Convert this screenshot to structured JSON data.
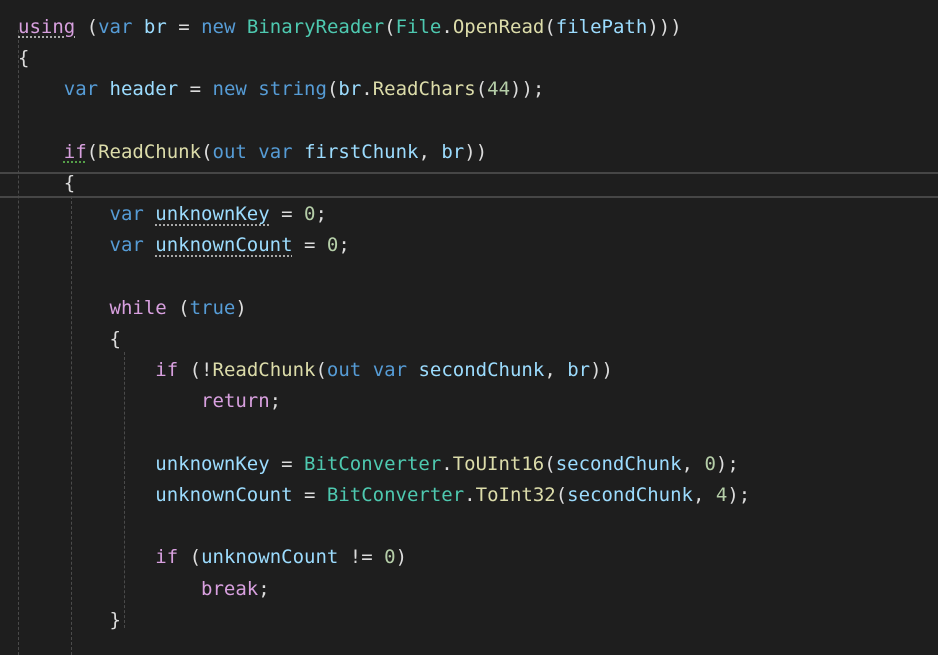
{
  "lines": [
    {
      "tokens": [
        {
          "t": "using",
          "c": "ctl",
          "sq": "plain"
        },
        {
          "t": " (",
          "c": "pun"
        },
        {
          "t": "var",
          "c": "kw"
        },
        {
          "t": " ",
          "c": "pun"
        },
        {
          "t": "br",
          "c": "var"
        },
        {
          "t": " = ",
          "c": "pun"
        },
        {
          "t": "new",
          "c": "kw"
        },
        {
          "t": " ",
          "c": "pun"
        },
        {
          "t": "BinaryReader",
          "c": "type"
        },
        {
          "t": "(",
          "c": "pun"
        },
        {
          "t": "File",
          "c": "type"
        },
        {
          "t": ".",
          "c": "pun"
        },
        {
          "t": "OpenRead",
          "c": "mth"
        },
        {
          "t": "(",
          "c": "pun"
        },
        {
          "t": "filePath",
          "c": "var"
        },
        {
          "t": ")))",
          "c": "pun"
        }
      ]
    },
    {
      "tokens": [
        {
          "t": "{",
          "c": "pun"
        }
      ]
    },
    {
      "tokens": [
        {
          "t": "    ",
          "c": "pun"
        },
        {
          "t": "var",
          "c": "kw"
        },
        {
          "t": " ",
          "c": "pun"
        },
        {
          "t": "header",
          "c": "var"
        },
        {
          "t": " = ",
          "c": "pun"
        },
        {
          "t": "new",
          "c": "kw"
        },
        {
          "t": " ",
          "c": "pun"
        },
        {
          "t": "string",
          "c": "kw"
        },
        {
          "t": "(",
          "c": "pun"
        },
        {
          "t": "br",
          "c": "var"
        },
        {
          "t": ".",
          "c": "pun"
        },
        {
          "t": "ReadChars",
          "c": "mth"
        },
        {
          "t": "(",
          "c": "pun"
        },
        {
          "t": "44",
          "c": "num"
        },
        {
          "t": "));",
          "c": "pun"
        }
      ]
    },
    {
      "tokens": []
    },
    {
      "tokens": [
        {
          "t": "    ",
          "c": "pun"
        },
        {
          "t": "if",
          "c": "ctl",
          "sq": "green"
        },
        {
          "t": "(",
          "c": "pun"
        },
        {
          "t": "ReadChunk",
          "c": "mth"
        },
        {
          "t": "(",
          "c": "pun"
        },
        {
          "t": "out",
          "c": "kw"
        },
        {
          "t": " ",
          "c": "pun"
        },
        {
          "t": "var",
          "c": "kw"
        },
        {
          "t": " ",
          "c": "pun"
        },
        {
          "t": "firstChunk",
          "c": "var"
        },
        {
          "t": ", ",
          "c": "pun"
        },
        {
          "t": "br",
          "c": "var"
        },
        {
          "t": "))",
          "c": "pun"
        }
      ]
    },
    {
      "tokens": [
        {
          "t": "    ",
          "c": "pun"
        },
        {
          "t": "{",
          "c": "pun"
        }
      ]
    },
    {
      "tokens": [
        {
          "t": "        ",
          "c": "pun"
        },
        {
          "t": "var",
          "c": "kw"
        },
        {
          "t": " ",
          "c": "pun"
        },
        {
          "t": "unknownKey",
          "c": "var",
          "sq": "plain"
        },
        {
          "t": " = ",
          "c": "pun"
        },
        {
          "t": "0",
          "c": "num"
        },
        {
          "t": ";",
          "c": "pun"
        }
      ]
    },
    {
      "tokens": [
        {
          "t": "        ",
          "c": "pun"
        },
        {
          "t": "var",
          "c": "kw"
        },
        {
          "t": " ",
          "c": "pun"
        },
        {
          "t": "unknownCount",
          "c": "var",
          "sq": "plain"
        },
        {
          "t": " = ",
          "c": "pun"
        },
        {
          "t": "0",
          "c": "num"
        },
        {
          "t": ";",
          "c": "pun"
        }
      ]
    },
    {
      "tokens": []
    },
    {
      "tokens": [
        {
          "t": "        ",
          "c": "pun"
        },
        {
          "t": "while",
          "c": "ctl"
        },
        {
          "t": " (",
          "c": "pun"
        },
        {
          "t": "true",
          "c": "kw"
        },
        {
          "t": ")",
          "c": "pun"
        }
      ]
    },
    {
      "tokens": [
        {
          "t": "        ",
          "c": "pun"
        },
        {
          "t": "{",
          "c": "pun"
        }
      ]
    },
    {
      "tokens": [
        {
          "t": "            ",
          "c": "pun"
        },
        {
          "t": "if",
          "c": "ctl"
        },
        {
          "t": " (!",
          "c": "pun"
        },
        {
          "t": "ReadChunk",
          "c": "mth"
        },
        {
          "t": "(",
          "c": "pun"
        },
        {
          "t": "out",
          "c": "kw"
        },
        {
          "t": " ",
          "c": "pun"
        },
        {
          "t": "var",
          "c": "kw"
        },
        {
          "t": " ",
          "c": "pun"
        },
        {
          "t": "secondChunk",
          "c": "var"
        },
        {
          "t": ", ",
          "c": "pun"
        },
        {
          "t": "br",
          "c": "var"
        },
        {
          "t": "))",
          "c": "pun"
        }
      ]
    },
    {
      "tokens": [
        {
          "t": "                ",
          "c": "pun"
        },
        {
          "t": "return",
          "c": "ctl"
        },
        {
          "t": ";",
          "c": "pun"
        }
      ]
    },
    {
      "tokens": []
    },
    {
      "tokens": [
        {
          "t": "            ",
          "c": "pun"
        },
        {
          "t": "unknownKey",
          "c": "var"
        },
        {
          "t": " = ",
          "c": "pun"
        },
        {
          "t": "BitConverter",
          "c": "type"
        },
        {
          "t": ".",
          "c": "pun"
        },
        {
          "t": "ToUInt16",
          "c": "mth"
        },
        {
          "t": "(",
          "c": "pun"
        },
        {
          "t": "secondChunk",
          "c": "var"
        },
        {
          "t": ", ",
          "c": "pun"
        },
        {
          "t": "0",
          "c": "num"
        },
        {
          "t": ");",
          "c": "pun"
        }
      ]
    },
    {
      "tokens": [
        {
          "t": "            ",
          "c": "pun"
        },
        {
          "t": "unknownCount",
          "c": "var"
        },
        {
          "t": " = ",
          "c": "pun"
        },
        {
          "t": "BitConverter",
          "c": "type"
        },
        {
          "t": ".",
          "c": "pun"
        },
        {
          "t": "ToInt32",
          "c": "mth"
        },
        {
          "t": "(",
          "c": "pun"
        },
        {
          "t": "secondChunk",
          "c": "var"
        },
        {
          "t": ", ",
          "c": "pun"
        },
        {
          "t": "4",
          "c": "num"
        },
        {
          "t": ");",
          "c": "pun"
        }
      ]
    },
    {
      "tokens": []
    },
    {
      "tokens": [
        {
          "t": "            ",
          "c": "pun"
        },
        {
          "t": "if",
          "c": "ctl"
        },
        {
          "t": " (",
          "c": "pun"
        },
        {
          "t": "unknownCount",
          "c": "var"
        },
        {
          "t": " != ",
          "c": "pun"
        },
        {
          "t": "0",
          "c": "num"
        },
        {
          "t": ")",
          "c": "pun"
        }
      ]
    },
    {
      "tokens": [
        {
          "t": "                ",
          "c": "pun"
        },
        {
          "t": "break",
          "c": "ctl"
        },
        {
          "t": ";",
          "c": "pun"
        }
      ]
    },
    {
      "tokens": [
        {
          "t": "        ",
          "c": "pun"
        },
        {
          "t": "}",
          "c": "pun"
        }
      ]
    },
    {
      "tokens": []
    }
  ],
  "colors": {
    "background": "#1e1e1e",
    "keyword": "#569cd6",
    "control": "#d8a0df",
    "type": "#4ec9b0",
    "method": "#dcdcaa",
    "variable": "#9cdcfe",
    "number": "#b5cea8",
    "punctuation": "#dcdcdc"
  }
}
